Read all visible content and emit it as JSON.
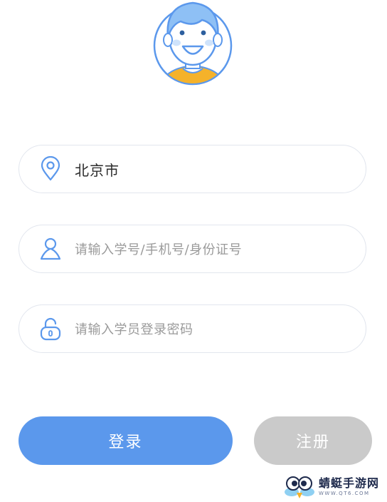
{
  "avatar": {
    "icon": "user-avatar-illustration"
  },
  "form": {
    "city": {
      "icon": "location-pin-icon",
      "value": "北京市"
    },
    "username": {
      "icon": "person-icon",
      "placeholder": "请输入学号/手机号/身份证号"
    },
    "password": {
      "icon": "lock-icon",
      "placeholder": "请输入学员登录密码"
    }
  },
  "buttons": {
    "login_label": "登录",
    "register_label": "注册"
  },
  "watermark": {
    "title": "蜻蜓手游网",
    "url": "WWW.QT6.COM"
  },
  "colors": {
    "primary": "#5b98ec",
    "disabled": "#cacaca",
    "field_border": "#e2e6ee",
    "icon": "#5b98ec"
  }
}
